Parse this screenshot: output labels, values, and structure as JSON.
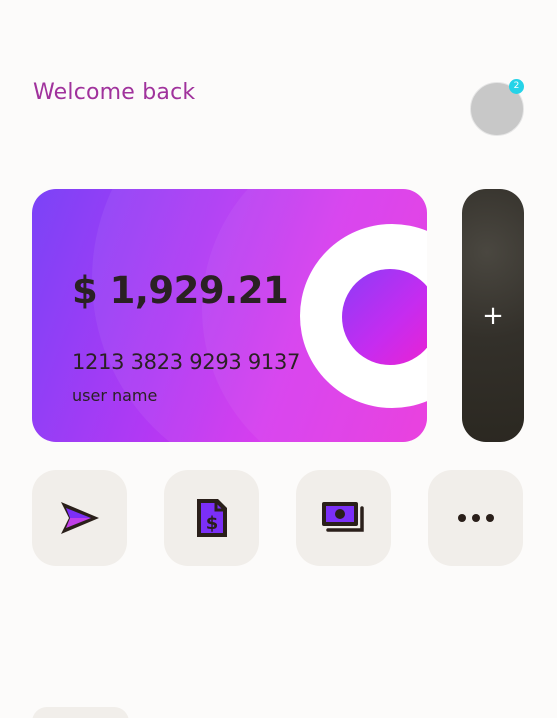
{
  "header": {
    "greeting": "Welcome back",
    "notification_count": "2"
  },
  "card": {
    "balance": "$ 1,929.21",
    "number": "1213 3823 9293 9137",
    "holder": "user name"
  },
  "add_card": {
    "label": "+"
  },
  "actions": [
    {
      "icon": "send-icon"
    },
    {
      "icon": "invoice-dollar-icon"
    },
    {
      "icon": "money-stack-icon"
    },
    {
      "icon": "more-dots-icon"
    }
  ],
  "colors": {
    "accent": "#a0329c",
    "badge": "#26d3e8",
    "icon_dark": "#2a1f1a",
    "icon_purple": "#7b2ff7",
    "tile_bg": "#f1eeea"
  }
}
